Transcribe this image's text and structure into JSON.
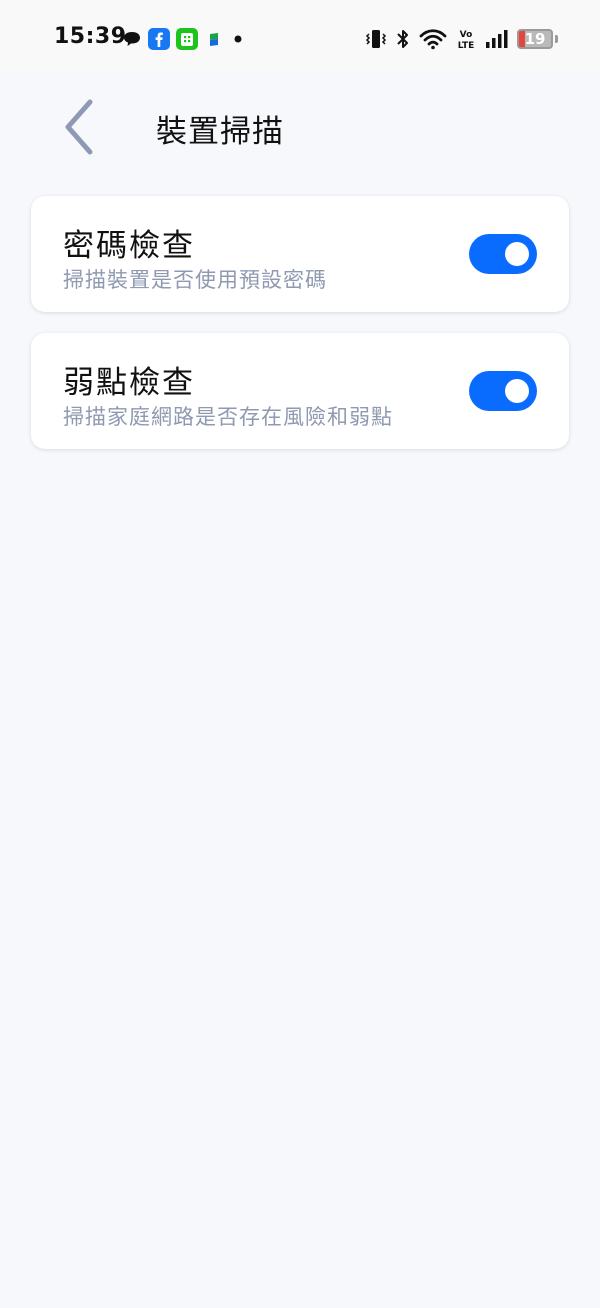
{
  "status_bar": {
    "time": "15:39",
    "battery_level": "19",
    "battery_percent": 19,
    "battery_color": "#e2463c",
    "notification_icons": [
      "chat-bubble-icon",
      "facebook-icon",
      "line-app-icon",
      "app-icon",
      "more-dot-icon"
    ],
    "system_icons": [
      "vibrate-icon",
      "bluetooth-icon",
      "wifi-icon",
      "volte-icon",
      "signal-icon",
      "battery-icon"
    ]
  },
  "header": {
    "title": "裝置掃描",
    "back_icon": "chevron-left-icon"
  },
  "settings": [
    {
      "title": "密碼檢查",
      "subtitle": "掃描裝置是否使用預設密碼",
      "enabled": true
    },
    {
      "title": "弱點檢查",
      "subtitle": "掃描家庭網路是否存在風險和弱點",
      "enabled": true
    }
  ],
  "colors": {
    "accent": "#0a6cff",
    "background": "#f6f8fc",
    "subtitle": "#8f99b0",
    "back_icon": "#8f99b6"
  }
}
